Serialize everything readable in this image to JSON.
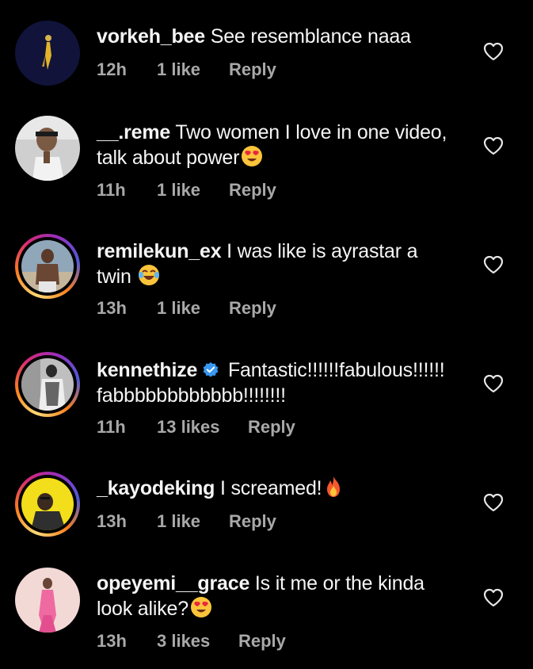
{
  "comments": [
    {
      "username": "vorkeh_bee",
      "text": "See resemblance naaa",
      "text_line2": "",
      "time": "12h",
      "likes": "1 like",
      "reply": "Reply",
      "emoji": ""
    },
    {
      "username": "__.reme",
      "text": "Two women I love in one video,",
      "text_line2": "talk about power",
      "time": "11h",
      "likes": "1 like",
      "reply": "Reply",
      "emoji": "heart-eyes"
    },
    {
      "username": "remilekun_ex",
      "text": "I was like is ayrastar a",
      "text_line2": "twin",
      "time": "13h",
      "likes": "1 like",
      "reply": "Reply",
      "emoji": "laughing-tears"
    },
    {
      "username": "kennethize",
      "text": "Fantastic!!!!!!fabulous!!!!!!",
      "text_line2": "fabbbbbbbbbbbb!!!!!!!!",
      "time": "11h",
      "likes": "13 likes",
      "reply": "Reply",
      "emoji": "",
      "verified": true
    },
    {
      "username": "_kayodeking",
      "text": "I screamed!",
      "text_line2": "",
      "time": "13h",
      "likes": "1 like",
      "reply": "Reply",
      "emoji": "fire"
    },
    {
      "username": "opeyemi__grace",
      "text": "Is it me or the kinda",
      "text_line2": "look alike?",
      "time": "13h",
      "likes": "3 likes",
      "reply": "Reply",
      "emoji": "heart-eyes"
    }
  ],
  "colors": {
    "background": "#000000",
    "primary_text": "#f5f5f5",
    "secondary_text": "#a8a8a8",
    "verified_blue": "#3897f0"
  },
  "icons": {
    "like": "heart-outline-icon",
    "verified": "verified-badge-icon"
  }
}
